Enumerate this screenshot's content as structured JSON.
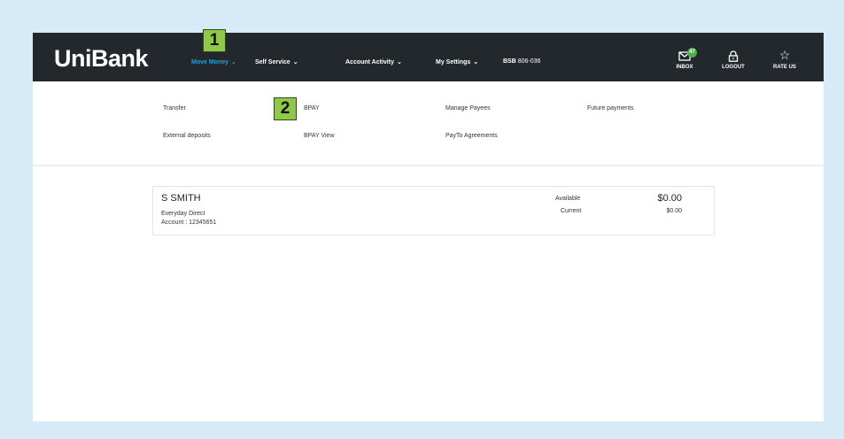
{
  "app": {
    "logo": "UniBank"
  },
  "nav": {
    "items": [
      {
        "label": "Move Money",
        "chevron": "⌄",
        "active": true
      },
      {
        "label": "Self Service",
        "chevron": "⌄"
      },
      {
        "label": "Account Activity",
        "chevron": "⌄"
      },
      {
        "label": "My Settings",
        "chevron": "⌄"
      }
    ],
    "bsb_label": "BSB",
    "bsb_value": "806-036"
  },
  "right_actions": {
    "inbox": {
      "label": "INBOX",
      "badge": "47",
      "icon": "mail-icon"
    },
    "logout": {
      "label": "LOGOUT",
      "icon": "lock-icon"
    },
    "rate": {
      "label": "RATE US",
      "icon": "star-icon"
    }
  },
  "steps": {
    "one": "1",
    "two": "2"
  },
  "submenu": {
    "transfer": "Transfer",
    "bpay": "BPAY",
    "manage_payees": "Manage Payees",
    "future_payments": "Future payments",
    "external_deposits": "External deposits",
    "bpay_view": "BPAY View",
    "payto_agreements": "PayTo Agreements"
  },
  "account": {
    "name": "S SMITH",
    "type": "Everyday Direct",
    "number": "Account : 12345651",
    "available_label": "Available",
    "available_value": "$0.00",
    "current_label": "Current",
    "current_value": "$0.00"
  },
  "colors": {
    "background": "#d6ebf7",
    "topbar": "#22282c",
    "active_nav": "#1aa3e0",
    "step_marker": "#8fc84a",
    "badge": "#4fae48"
  }
}
